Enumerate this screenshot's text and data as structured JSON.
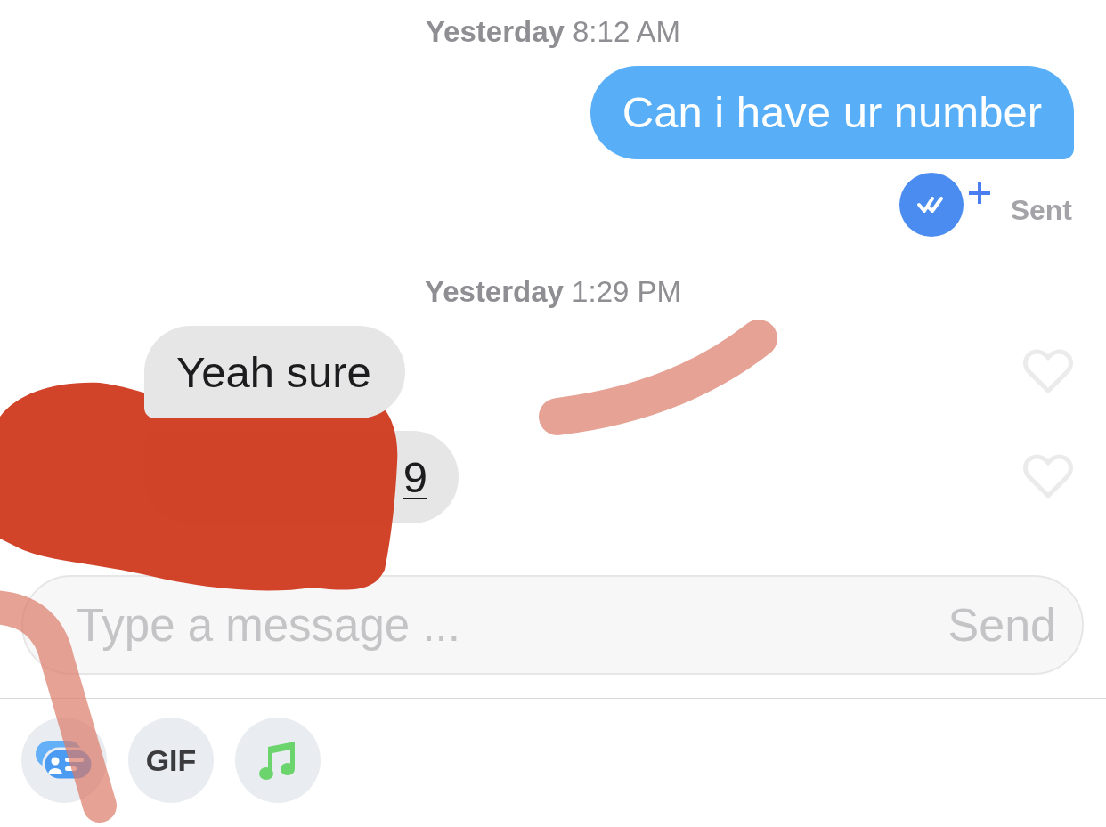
{
  "thread": [
    {
      "kind": "timestamp",
      "text": "**Yesterday** 8:12 AM"
    },
    {
      "kind": "sent",
      "text": "Can i have ur number",
      "status": "Sent"
    },
    {
      "kind": "timestamp",
      "text": "**Yesterday** 1:29 PM"
    },
    {
      "kind": "received",
      "text": "Yeah sure",
      "link": false,
      "liked": false
    },
    {
      "kind": "received",
      "text": "9",
      "link": true,
      "liked": false
    }
  ],
  "composer": {
    "placeholder": "Type a message ...",
    "send": "Send"
  },
  "attachments": [
    {
      "kind": "card"
    },
    {
      "kind": "gif",
      "label": "GIF"
    },
    {
      "kind": "music"
    }
  ]
}
